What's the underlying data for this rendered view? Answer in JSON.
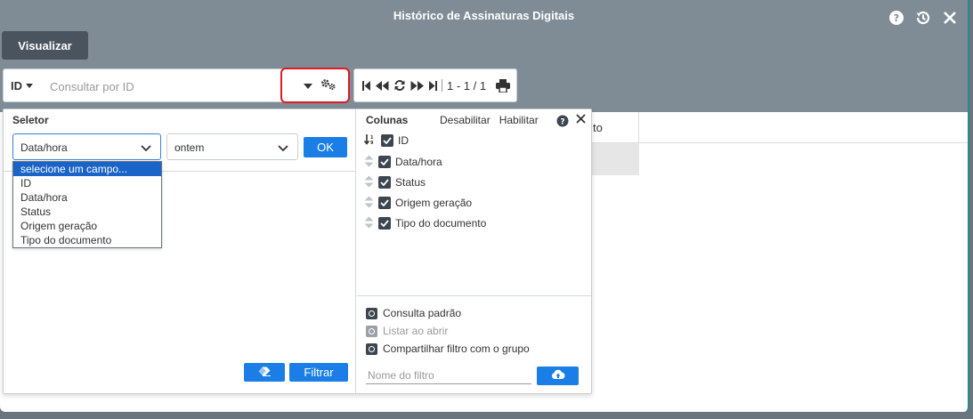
{
  "window": {
    "title": "Histórico de Assinaturas Digitais"
  },
  "header_icons": {
    "help": "help-icon",
    "history": "history-icon",
    "close": "close-icon"
  },
  "toolbar": {
    "view_label": "Visualizar"
  },
  "search": {
    "field": "ID",
    "placeholder": "Consultar por ID"
  },
  "pager": {
    "count": "1 - 1 / 1"
  },
  "grid": {
    "partial_header": "to"
  },
  "selector": {
    "title": "Seletor",
    "field_value": "Data/hora",
    "period_value": "ontem",
    "ok_label": "OK",
    "dropdown": [
      "selecione um campo...",
      "ID",
      "Data/hora",
      "Status",
      "Origem geração",
      "Tipo do documento"
    ],
    "filter_label": "Filtrar"
  },
  "columns": {
    "title": "Colunas",
    "disable_label": "Desabilitar",
    "enable_label": "Habilitar",
    "items": [
      "ID",
      "Data/hora",
      "Status",
      "Origem geração",
      "Tipo do documento"
    ]
  },
  "options": {
    "default_query": "Consulta padrão",
    "list_on_open": "Listar ao abrir",
    "share_filter": "Compartilhar filtro com o grupo",
    "filter_name_placeholder": "Nome do filtro"
  },
  "colors": {
    "primary": "#1a7ee6",
    "header": "#7f8c96",
    "highlight": "#e01b22"
  }
}
